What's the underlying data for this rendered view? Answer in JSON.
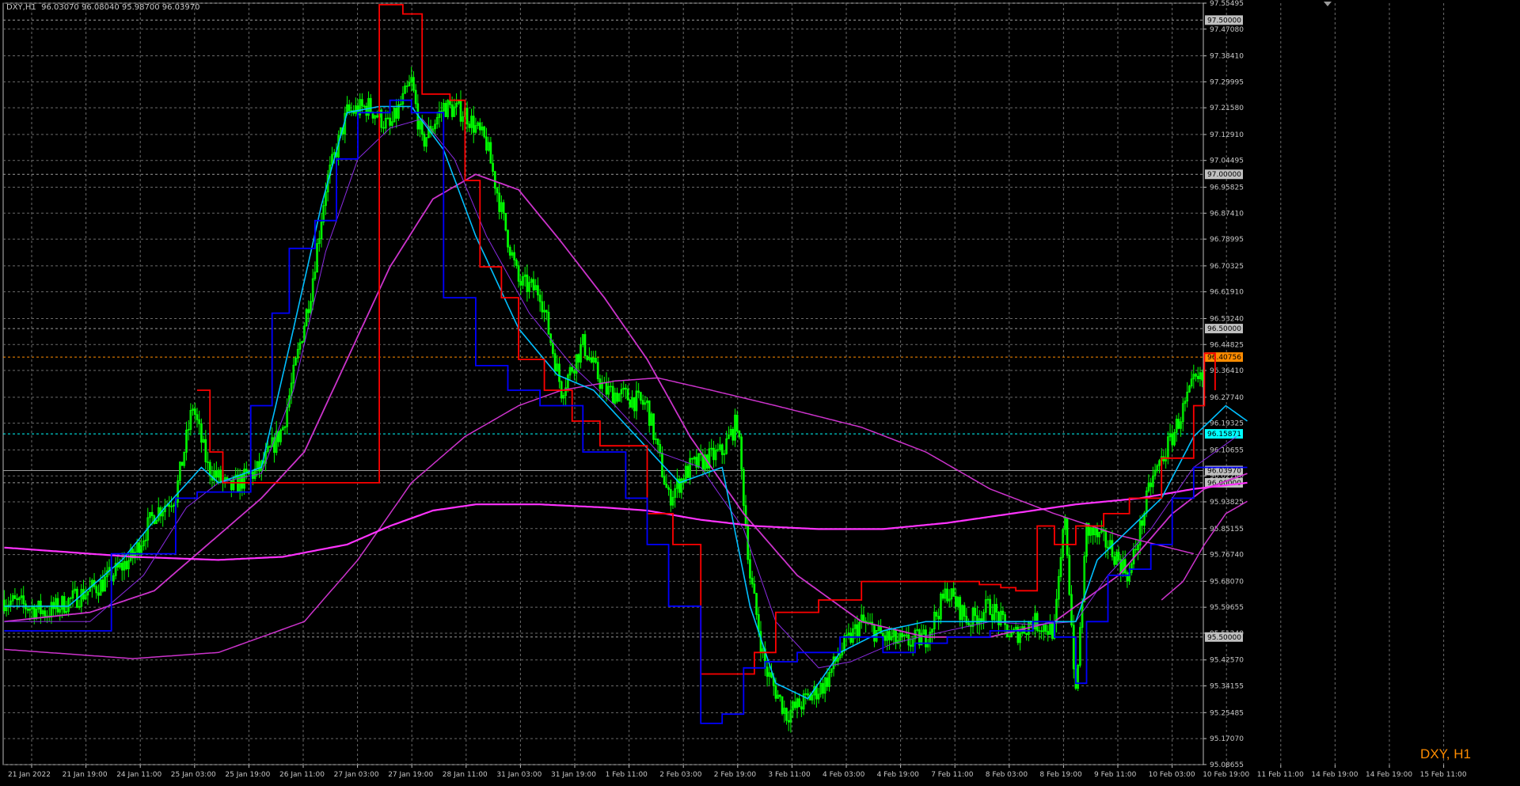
{
  "header": {
    "symbol_info": "DXY,H1  96.03070 96.08040 95.98700 96.03970"
  },
  "watermark": "DXY, H1",
  "colors": {
    "background": "#000000",
    "grid": "#6b6b6b",
    "candle": "#00ff00",
    "red_line": "#ff0000",
    "blue_line": "#0000ff",
    "fast_ma": "#00bfff",
    "slow_ma": "#cc33cc",
    "long_ma": "#ff33ff",
    "level_orange": "#ff8c00",
    "level_cyan": "#00ffff",
    "level_gray": "#c0c0c0"
  },
  "chart_data": {
    "type": "line",
    "ylim": [
      95.0863,
      97.5549
    ],
    "y_ticks": [
      "97.55495",
      "97.47080",
      "97.38410",
      "97.29995",
      "97.21580",
      "97.12910",
      "97.04495",
      "96.95825",
      "96.87410",
      "96.78995",
      "96.70325",
      "96.61910",
      "96.53240",
      "96.44825",
      "96.36410",
      "96.27740",
      "96.19325",
      "96.10655",
      "96.02240",
      "95.93825",
      "95.85155",
      "95.76740",
      "95.68070",
      "95.59655",
      "95.51240",
      "95.42570",
      "95.34155",
      "95.25485",
      "95.17070",
      "95.08655"
    ],
    "x_ticks": [
      "21 Jan 2022",
      "21 Jan 19:00",
      "24 Jan 11:00",
      "25 Jan 03:00",
      "25 Jan 19:00",
      "26 Jan 11:00",
      "27 Jan 03:00",
      "27 Jan 19:00",
      "28 Jan 11:00",
      "31 Jan 03:00",
      "31 Jan 19:00",
      "1 Feb 11:00",
      "2 Feb 03:00",
      "2 Feb 19:00",
      "3 Feb 11:00",
      "4 Feb 03:00",
      "4 Feb 19:00",
      "7 Feb 11:00",
      "8 Feb 03:00",
      "8 Feb 19:00",
      "9 Feb 11:00",
      "10 Feb 03:00",
      "10 Feb 19:00",
      "11 Feb 11:00",
      "14 Feb 19:00",
      "14 Feb 19:00",
      "15 Feb 11:00"
    ],
    "levels": [
      {
        "value": 97.5,
        "label": "97.50000",
        "style": "gray"
      },
      {
        "value": 97.0,
        "label": "97.00000",
        "style": "gray"
      },
      {
        "value": 96.5,
        "label": "96.50000",
        "style": "gray"
      },
      {
        "value": 96.40756,
        "label": "96.40756",
        "style": "orange"
      },
      {
        "value": 96.15871,
        "label": "96.15871",
        "style": "cyan"
      },
      {
        "value": 96.0397,
        "label": "96.03970",
        "style": "bid"
      },
      {
        "value": 96.0,
        "label": "96.00000",
        "style": "gray"
      },
      {
        "value": 95.5,
        "label": "95.50000",
        "style": "gray"
      }
    ],
    "n_bars": 560,
    "price_path": [
      [
        0,
        95.62
      ],
      [
        20,
        95.58
      ],
      [
        45,
        95.67
      ],
      [
        60,
        95.76
      ],
      [
        70,
        95.9
      ],
      [
        80,
        95.96
      ],
      [
        88,
        96.25
      ],
      [
        95,
        96.05
      ],
      [
        105,
        95.98
      ],
      [
        120,
        96.05
      ],
      [
        130,
        96.18
      ],
      [
        143,
        96.62
      ],
      [
        150,
        96.96
      ],
      [
        160,
        97.2
      ],
      [
        170,
        97.22
      ],
      [
        180,
        97.15
      ],
      [
        190,
        97.3
      ],
      [
        195,
        97.1
      ],
      [
        205,
        97.22
      ],
      [
        215,
        97.2
      ],
      [
        225,
        97.1
      ],
      [
        233,
        96.85
      ],
      [
        240,
        96.65
      ],
      [
        250,
        96.62
      ],
      [
        260,
        96.3
      ],
      [
        270,
        96.45
      ],
      [
        280,
        96.3
      ],
      [
        290,
        96.28
      ],
      [
        300,
        96.25
      ],
      [
        310,
        95.95
      ],
      [
        320,
        96.05
      ],
      [
        335,
        96.1
      ],
      [
        342,
        96.2
      ],
      [
        348,
        95.7
      ],
      [
        355,
        95.4
      ],
      [
        365,
        95.25
      ],
      [
        375,
        95.3
      ],
      [
        383,
        95.35
      ],
      [
        390,
        95.45
      ],
      [
        400,
        95.55
      ],
      [
        410,
        95.5
      ],
      [
        420,
        95.48
      ],
      [
        430,
        95.5
      ],
      [
        440,
        95.65
      ],
      [
        450,
        95.55
      ],
      [
        460,
        95.6
      ],
      [
        470,
        95.5
      ],
      [
        480,
        95.55
      ],
      [
        490,
        95.52
      ],
      [
        495,
        95.9
      ],
      [
        500,
        95.3
      ],
      [
        505,
        95.85
      ],
      [
        515,
        95.8
      ],
      [
        525,
        95.7
      ],
      [
        535,
        96.0
      ],
      [
        545,
        96.15
      ],
      [
        555,
        96.32
      ],
      [
        565,
        96.35
      ],
      [
        575,
        96.2
      ],
      [
        580,
        96.04
      ]
    ],
    "red_steps": [
      [
        90,
        96.3
      ],
      [
        96,
        96.1
      ],
      [
        102,
        96.0
      ],
      [
        140,
        96.0
      ],
      [
        175,
        97.55
      ],
      [
        186,
        97.52
      ],
      [
        195,
        97.26
      ],
      [
        208,
        97.24
      ],
      [
        215,
        96.98
      ],
      [
        222,
        96.7
      ],
      [
        232,
        96.6
      ],
      [
        240,
        96.4
      ],
      [
        252,
        96.3
      ],
      [
        265,
        96.2
      ],
      [
        278,
        96.12
      ],
      [
        290,
        96.12
      ],
      [
        300,
        95.9
      ],
      [
        312,
        95.8
      ],
      [
        325,
        95.38
      ],
      [
        335,
        95.38
      ],
      [
        350,
        95.45
      ],
      [
        360,
        95.58
      ],
      [
        380,
        95.62
      ],
      [
        400,
        95.68
      ],
      [
        420,
        95.68
      ],
      [
        445,
        95.68
      ],
      [
        455,
        95.67
      ],
      [
        465,
        95.66
      ],
      [
        472,
        95.65
      ],
      [
        482,
        95.86
      ],
      [
        490,
        95.8
      ],
      [
        500,
        95.86
      ],
      [
        513,
        95.9
      ],
      [
        525,
        95.95
      ],
      [
        540,
        96.08
      ],
      [
        555,
        96.25
      ],
      [
        560,
        96.42
      ],
      [
        565,
        96.3
      ]
    ],
    "blue_steps": [
      [
        0,
        95.52
      ],
      [
        40,
        95.52
      ],
      [
        50,
        95.77
      ],
      [
        70,
        95.77
      ],
      [
        80,
        95.95
      ],
      [
        90,
        95.97
      ],
      [
        100,
        95.97
      ],
      [
        108,
        95.97
      ],
      [
        115,
        96.25
      ],
      [
        125,
        96.55
      ],
      [
        133,
        96.76
      ],
      [
        145,
        96.85
      ],
      [
        155,
        97.05
      ],
      [
        165,
        97.2
      ],
      [
        180,
        97.24
      ],
      [
        190,
        97.2
      ],
      [
        205,
        96.6
      ],
      [
        220,
        96.38
      ],
      [
        235,
        96.3
      ],
      [
        250,
        96.25
      ],
      [
        270,
        96.1
      ],
      [
        290,
        95.95
      ],
      [
        300,
        95.8
      ],
      [
        310,
        95.6
      ],
      [
        325,
        95.22
      ],
      [
        335,
        95.25
      ],
      [
        345,
        95.4
      ],
      [
        355,
        95.42
      ],
      [
        370,
        95.45
      ],
      [
        390,
        95.5
      ],
      [
        410,
        95.45
      ],
      [
        425,
        95.48
      ],
      [
        440,
        95.5
      ],
      [
        460,
        95.52
      ],
      [
        480,
        95.55
      ],
      [
        490,
        95.5
      ],
      [
        500,
        95.35
      ],
      [
        505,
        95.55
      ],
      [
        515,
        95.7
      ],
      [
        525,
        95.72
      ],
      [
        535,
        95.8
      ],
      [
        545,
        95.95
      ],
      [
        555,
        96.05
      ],
      [
        565,
        96.05
      ],
      [
        580,
        96.05
      ]
    ],
    "fast_ma_path": [
      [
        0,
        95.6
      ],
      [
        30,
        95.6
      ],
      [
        55,
        95.75
      ],
      [
        75,
        95.92
      ],
      [
        92,
        96.05
      ],
      [
        100,
        96.0
      ],
      [
        120,
        96.05
      ],
      [
        135,
        96.5
      ],
      [
        148,
        96.9
      ],
      [
        160,
        97.2
      ],
      [
        175,
        97.22
      ],
      [
        190,
        97.22
      ],
      [
        205,
        97.08
      ],
      [
        220,
        96.8
      ],
      [
        240,
        96.5
      ],
      [
        258,
        96.35
      ],
      [
        275,
        96.3
      ],
      [
        295,
        96.15
      ],
      [
        315,
        96.0
      ],
      [
        335,
        96.05
      ],
      [
        348,
        95.6
      ],
      [
        360,
        95.35
      ],
      [
        375,
        95.3
      ],
      [
        390,
        95.45
      ],
      [
        410,
        95.52
      ],
      [
        430,
        95.55
      ],
      [
        450,
        95.55
      ],
      [
        470,
        95.55
      ],
      [
        490,
        95.55
      ],
      [
        500,
        95.55
      ],
      [
        510,
        95.75
      ],
      [
        525,
        95.85
      ],
      [
        540,
        95.95
      ],
      [
        555,
        96.15
      ],
      [
        570,
        96.25
      ],
      [
        580,
        96.2
      ]
    ],
    "med_ma_path": [
      [
        0,
        95.55
      ],
      [
        40,
        95.55
      ],
      [
        65,
        95.7
      ],
      [
        85,
        95.92
      ],
      [
        100,
        96.0
      ],
      [
        120,
        96.03
      ],
      [
        135,
        96.3
      ],
      [
        150,
        96.75
      ],
      [
        165,
        97.05
      ],
      [
        180,
        97.15
      ],
      [
        195,
        97.18
      ],
      [
        210,
        97.05
      ],
      [
        225,
        96.8
      ],
      [
        245,
        96.55
      ],
      [
        265,
        96.38
      ],
      [
        285,
        96.25
      ],
      [
        305,
        96.1
      ],
      [
        325,
        96.05
      ],
      [
        345,
        95.85
      ],
      [
        360,
        95.55
      ],
      [
        380,
        95.4
      ],
      [
        395,
        95.42
      ],
      [
        415,
        95.48
      ],
      [
        440,
        95.52
      ],
      [
        460,
        95.55
      ],
      [
        480,
        95.54
      ],
      [
        500,
        95.55
      ],
      [
        515,
        95.7
      ],
      [
        535,
        95.85
      ],
      [
        555,
        96.05
      ],
      [
        575,
        96.15
      ]
    ],
    "slow_ma_path": [
      [
        0,
        95.55
      ],
      [
        40,
        95.58
      ],
      [
        70,
        95.65
      ],
      [
        95,
        95.8
      ],
      [
        120,
        95.95
      ],
      [
        140,
        96.1
      ],
      [
        160,
        96.4
      ],
      [
        180,
        96.7
      ],
      [
        200,
        96.92
      ],
      [
        220,
        97.0
      ],
      [
        240,
        96.95
      ],
      [
        260,
        96.78
      ],
      [
        280,
        96.6
      ],
      [
        300,
        96.4
      ],
      [
        320,
        96.15
      ],
      [
        345,
        95.9
      ],
      [
        370,
        95.7
      ],
      [
        400,
        95.55
      ],
      [
        430,
        95.5
      ],
      [
        460,
        95.5
      ],
      [
        490,
        95.55
      ],
      [
        520,
        95.7
      ],
      [
        545,
        95.9
      ],
      [
        560,
        95.98
      ],
      [
        580,
        96.03
      ]
    ],
    "lower_ma_path": [
      [
        0,
        95.46
      ],
      [
        60,
        95.43
      ],
      [
        100,
        95.45
      ],
      [
        140,
        95.55
      ],
      [
        165,
        95.75
      ],
      [
        190,
        96.0
      ],
      [
        215,
        96.15
      ],
      [
        240,
        96.25
      ],
      [
        260,
        96.3
      ],
      [
        285,
        96.33
      ],
      [
        305,
        96.34
      ],
      [
        330,
        96.3
      ],
      [
        360,
        96.25
      ],
      [
        400,
        96.18
      ],
      [
        430,
        96.1
      ],
      [
        460,
        95.98
      ],
      [
        490,
        95.9
      ],
      [
        520,
        95.83
      ],
      [
        555,
        95.77
      ]
    ],
    "long_ma_path": [
      [
        0,
        95.79
      ],
      [
        60,
        95.76
      ],
      [
        100,
        95.75
      ],
      [
        130,
        95.76
      ],
      [
        160,
        95.8
      ],
      [
        180,
        95.86
      ],
      [
        200,
        95.91
      ],
      [
        220,
        95.93
      ],
      [
        250,
        95.93
      ],
      [
        280,
        95.92
      ],
      [
        300,
        95.91
      ],
      [
        325,
        95.88
      ],
      [
        350,
        95.86
      ],
      [
        380,
        95.85
      ],
      [
        410,
        95.85
      ],
      [
        440,
        95.87
      ],
      [
        470,
        95.9
      ],
      [
        500,
        95.93
      ],
      [
        530,
        95.95
      ],
      [
        555,
        95.98
      ],
      [
        580,
        96.0
      ]
    ],
    "bottom_ma_path": [
      [
        540,
        95.62
      ],
      [
        550,
        95.68
      ],
      [
        560,
        95.8
      ],
      [
        570,
        95.9
      ],
      [
        580,
        95.94
      ]
    ]
  }
}
